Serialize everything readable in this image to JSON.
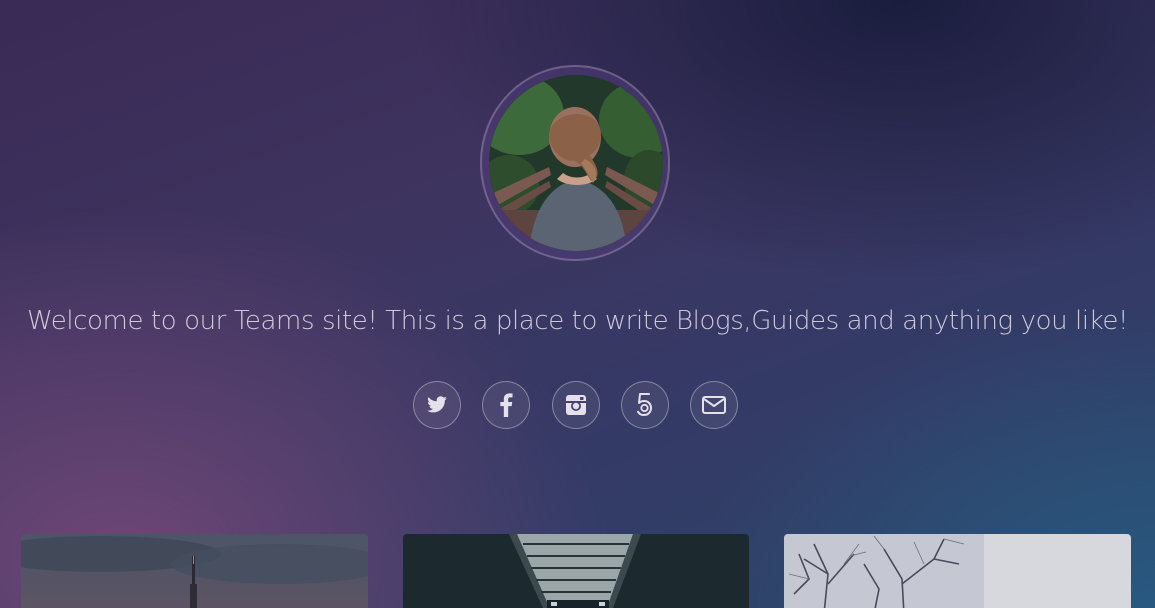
{
  "hero": {
    "welcome_text": "Welcome to our Teams site! This is a place to write Blogs,Guides and anything you like!",
    "avatar_alt": "Team member photo"
  },
  "social_links": [
    {
      "icon": "twitter-icon"
    },
    {
      "icon": "facebook-icon"
    },
    {
      "icon": "instagram-icon"
    },
    {
      "icon": "500px-icon"
    },
    {
      "icon": "mail-icon"
    }
  ],
  "cards": [
    {
      "image": "city-tower-dusk"
    },
    {
      "image": "station-skylight"
    },
    {
      "image": "snowy-trees"
    }
  ],
  "colors": {
    "icon": "#e4e0ec",
    "ring": "rgba(255,255,255,0.35)",
    "text": "rgba(225,220,235,0.88)"
  }
}
